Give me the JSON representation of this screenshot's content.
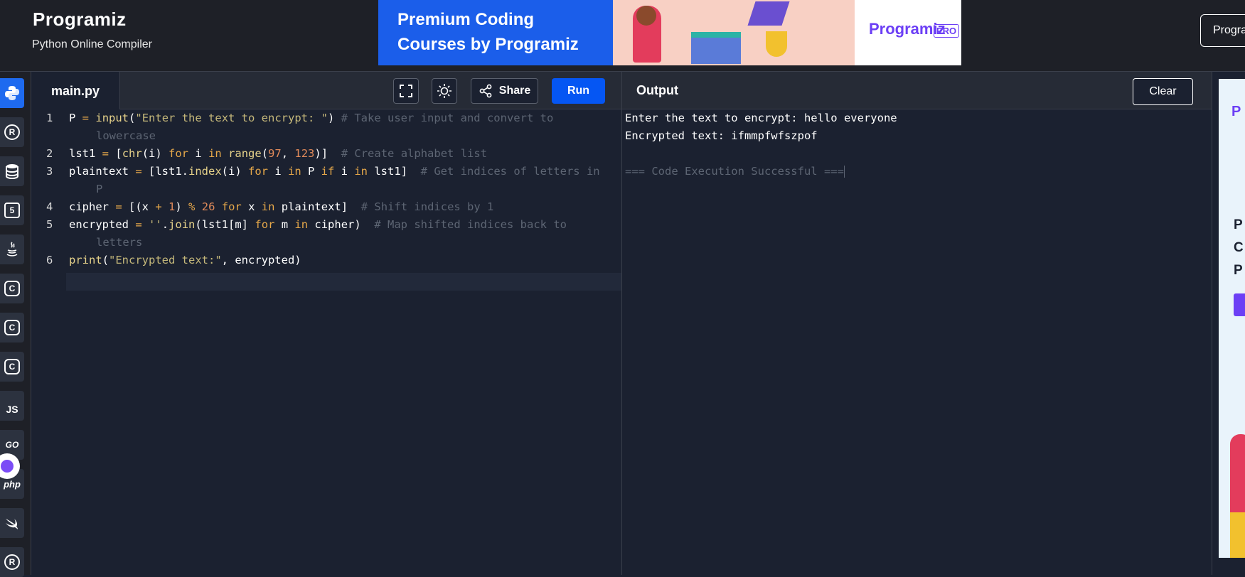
{
  "header": {
    "logo": "Programiz",
    "subtitle": "Python Online Compiler",
    "top_button": "Progra"
  },
  "banner": {
    "line1": "Premium Coding",
    "line2": "Courses by Programiz",
    "brand": "Programiz",
    "brand_badge": "PRO"
  },
  "sidebar": {
    "languages": [
      {
        "name": "python-icon",
        "label": "",
        "active": true
      },
      {
        "name": "r-icon",
        "label": "R"
      },
      {
        "name": "database-icon",
        "label": ""
      },
      {
        "name": "html5-icon",
        "label": "5"
      },
      {
        "name": "java-icon",
        "label": ""
      },
      {
        "name": "c-icon",
        "label": "C"
      },
      {
        "name": "cpp-icon",
        "label": "C"
      },
      {
        "name": "csharp-icon",
        "label": "C"
      },
      {
        "name": "javascript-icon",
        "label": "JS"
      },
      {
        "name": "go-icon",
        "label": "GO"
      },
      {
        "name": "php-icon",
        "label": "php"
      },
      {
        "name": "swift-icon",
        "label": ""
      },
      {
        "name": "rust-icon",
        "label": "R"
      }
    ]
  },
  "editor": {
    "file_tab": "main.py",
    "share_label": "Share",
    "run_label": "Run"
  },
  "output": {
    "title": "Output",
    "clear_label": "Clear",
    "lines": [
      "Enter the text to encrypt: hello everyone",
      "Encrypted text: ifmmpfwfszpof",
      "",
      "=== Code Execution Successful ==="
    ]
  },
  "side_ad": {
    "logo": "P",
    "text_lines": [
      "P",
      "C",
      "P"
    ]
  },
  "colors": {
    "accent": "#0556f3",
    "active_lang": "#1e6aef",
    "brand_purple": "#6c3ff5",
    "editor_bg": "#1b2130",
    "header_bg": "#1e2027"
  }
}
